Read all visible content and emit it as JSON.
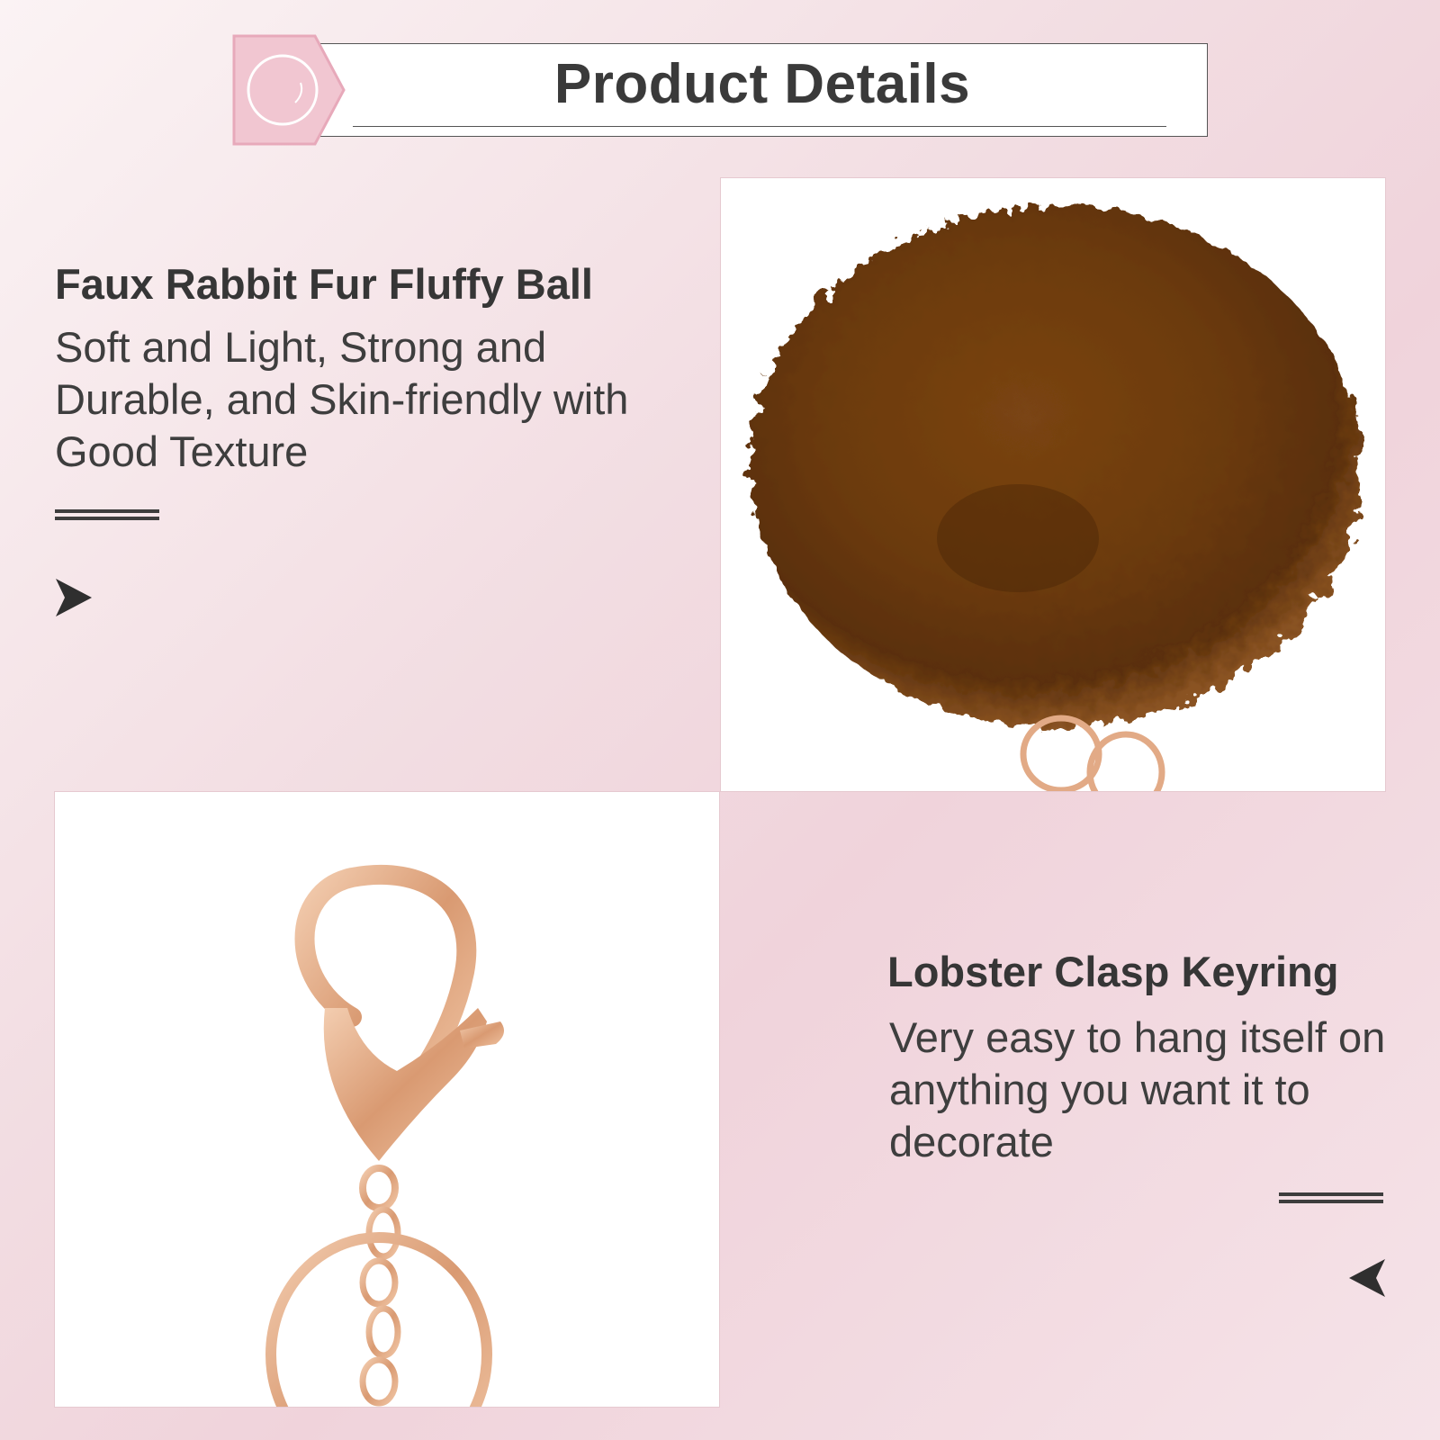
{
  "header": {
    "title": "Product Details"
  },
  "features": [
    {
      "title": "Faux Rabbit Fur Fluffy Ball",
      "description": "Soft and Light, Strong and Durable, and Skin-friendly with Good Texture"
    },
    {
      "title": "Lobster Clasp Keyring",
      "description": "Very easy to hang itself on anything you want it to decorate"
    }
  ],
  "colors": {
    "accent_pink": "#f1c6d1",
    "text_dark": "#363636",
    "fur_brown": "#6e3d10",
    "metal_rose_gold": "#e2aa86"
  },
  "icons": {
    "header_badge": "circle-tag-icon",
    "pointer_right": "triangle-right-icon",
    "pointer_left": "triangle-left-icon"
  }
}
